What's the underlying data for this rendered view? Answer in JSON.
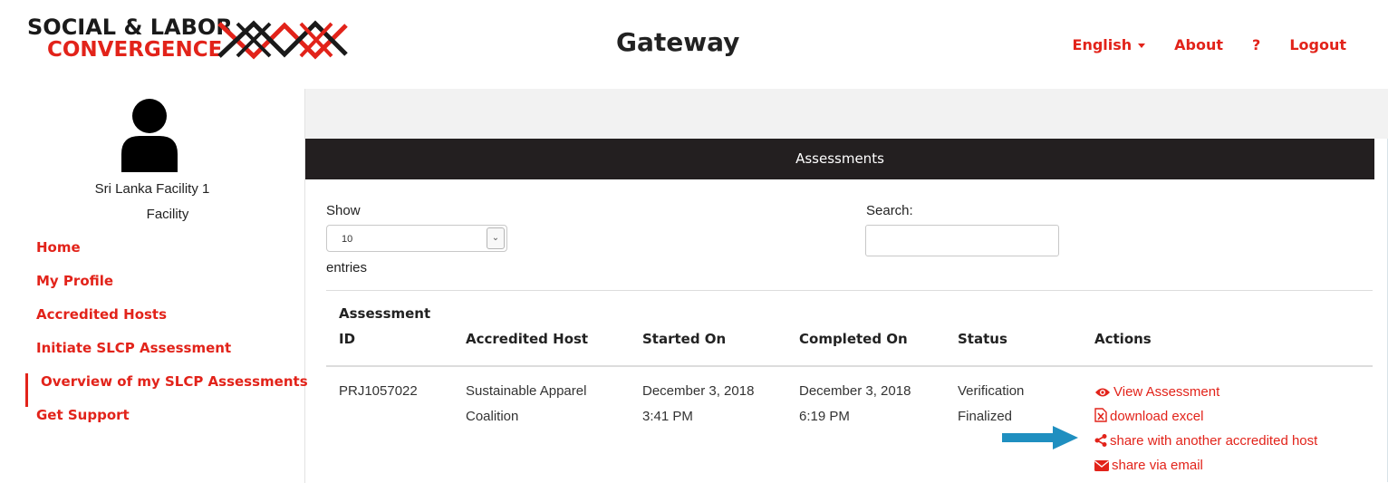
{
  "brand": {
    "logo_line1": "SOCIAL & LABOR",
    "logo_line2": "CONVERGENCE",
    "app_title": "Gateway",
    "accent_color": "#e2231a"
  },
  "topnav": {
    "language": "English",
    "about": "About",
    "help": "?",
    "logout": "Logout"
  },
  "sidebar": {
    "facility_name": "Sri Lanka Facility 1",
    "facility_type": "Facility",
    "items": [
      {
        "label": "Home"
      },
      {
        "label": "My Profile"
      },
      {
        "label": "Accredited Hosts"
      },
      {
        "label": "Initiate SLCP Assessment"
      },
      {
        "label": "Overview of my SLCP Assessments"
      },
      {
        "label": "Get Support"
      }
    ],
    "active_index": 4
  },
  "panel": {
    "title": "Assessments",
    "show_label": "Show",
    "length_value": "10",
    "entries_label": "entries",
    "search_label": "Search:",
    "search_value": ""
  },
  "table": {
    "headers": {
      "id_line1": "Assessment",
      "id_line2": "ID",
      "host": "Accredited Host",
      "started": "Started On",
      "completed": "Completed On",
      "status": "Status",
      "actions": "Actions"
    },
    "rows": [
      {
        "id": "PRJ1057022",
        "host_line1": "Sustainable Apparel",
        "host_line2": "Coalition",
        "started_line1": "December 3, 2018",
        "started_line2": "3:41 PM",
        "completed_line1": "December 3, 2018",
        "completed_line2": "6:19 PM",
        "status_line1": "Verification",
        "status_line2": "Finalized",
        "actions": {
          "view": "View Assessment",
          "download": "download excel",
          "share_host": "share with another accredited host",
          "share_email": "share via email"
        }
      }
    ]
  },
  "icons": {
    "view": "eye-icon",
    "download": "excel-file-icon",
    "share_host": "share-icon",
    "share_email": "envelope-icon",
    "pointer": "blue-arrow-icon"
  }
}
